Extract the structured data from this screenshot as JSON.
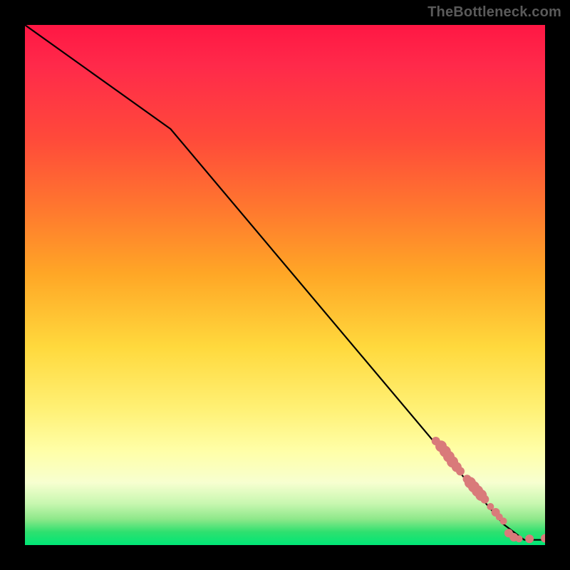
{
  "watermark": "TheBottleneck.com",
  "colors": {
    "background": "#000000",
    "line": "#000000",
    "marker": "#d97a7a",
    "gradient_top": "#ff1744",
    "gradient_bottom": "#00e676"
  },
  "chart_data": {
    "type": "line",
    "title": "",
    "xlabel": "",
    "ylabel": "",
    "xlim": [
      0,
      100
    ],
    "ylim": [
      0,
      100
    ],
    "grid": false,
    "legend": false,
    "line_path": [
      {
        "x": 0,
        "y": 100
      },
      {
        "x": 28,
        "y": 80
      },
      {
        "x": 92,
        "y": 4
      },
      {
        "x": 96,
        "y": 1
      },
      {
        "x": 100,
        "y": 1
      }
    ],
    "series": [
      {
        "name": "data-points",
        "color": "#d97a7a",
        "points": [
          {
            "x": 79,
            "y": 20,
            "size": 6
          },
          {
            "x": 80,
            "y": 19,
            "size": 8
          },
          {
            "x": 80.8,
            "y": 18,
            "size": 8
          },
          {
            "x": 81.5,
            "y": 17,
            "size": 8
          },
          {
            "x": 82.2,
            "y": 16,
            "size": 8
          },
          {
            "x": 83,
            "y": 15,
            "size": 7
          },
          {
            "x": 83.7,
            "y": 14.2,
            "size": 6
          },
          {
            "x": 85,
            "y": 12.7,
            "size": 6
          },
          {
            "x": 85.6,
            "y": 12,
            "size": 8
          },
          {
            "x": 86.3,
            "y": 11.2,
            "size": 8
          },
          {
            "x": 87,
            "y": 10.4,
            "size": 8
          },
          {
            "x": 87.7,
            "y": 9.6,
            "size": 8
          },
          {
            "x": 88.4,
            "y": 8.8,
            "size": 6
          },
          {
            "x": 89.5,
            "y": 7.4,
            "size": 5
          },
          {
            "x": 90.5,
            "y": 6.3,
            "size": 6
          },
          {
            "x": 91.2,
            "y": 5.4,
            "size": 5
          },
          {
            "x": 92,
            "y": 4.6,
            "size": 5
          },
          {
            "x": 93,
            "y": 2.3,
            "size": 6
          },
          {
            "x": 94,
            "y": 1.5,
            "size": 6
          },
          {
            "x": 95,
            "y": 1.2,
            "size": 5
          },
          {
            "x": 97,
            "y": 1.2,
            "size": 6
          },
          {
            "x": 100,
            "y": 1.3,
            "size": 6
          }
        ]
      }
    ]
  }
}
